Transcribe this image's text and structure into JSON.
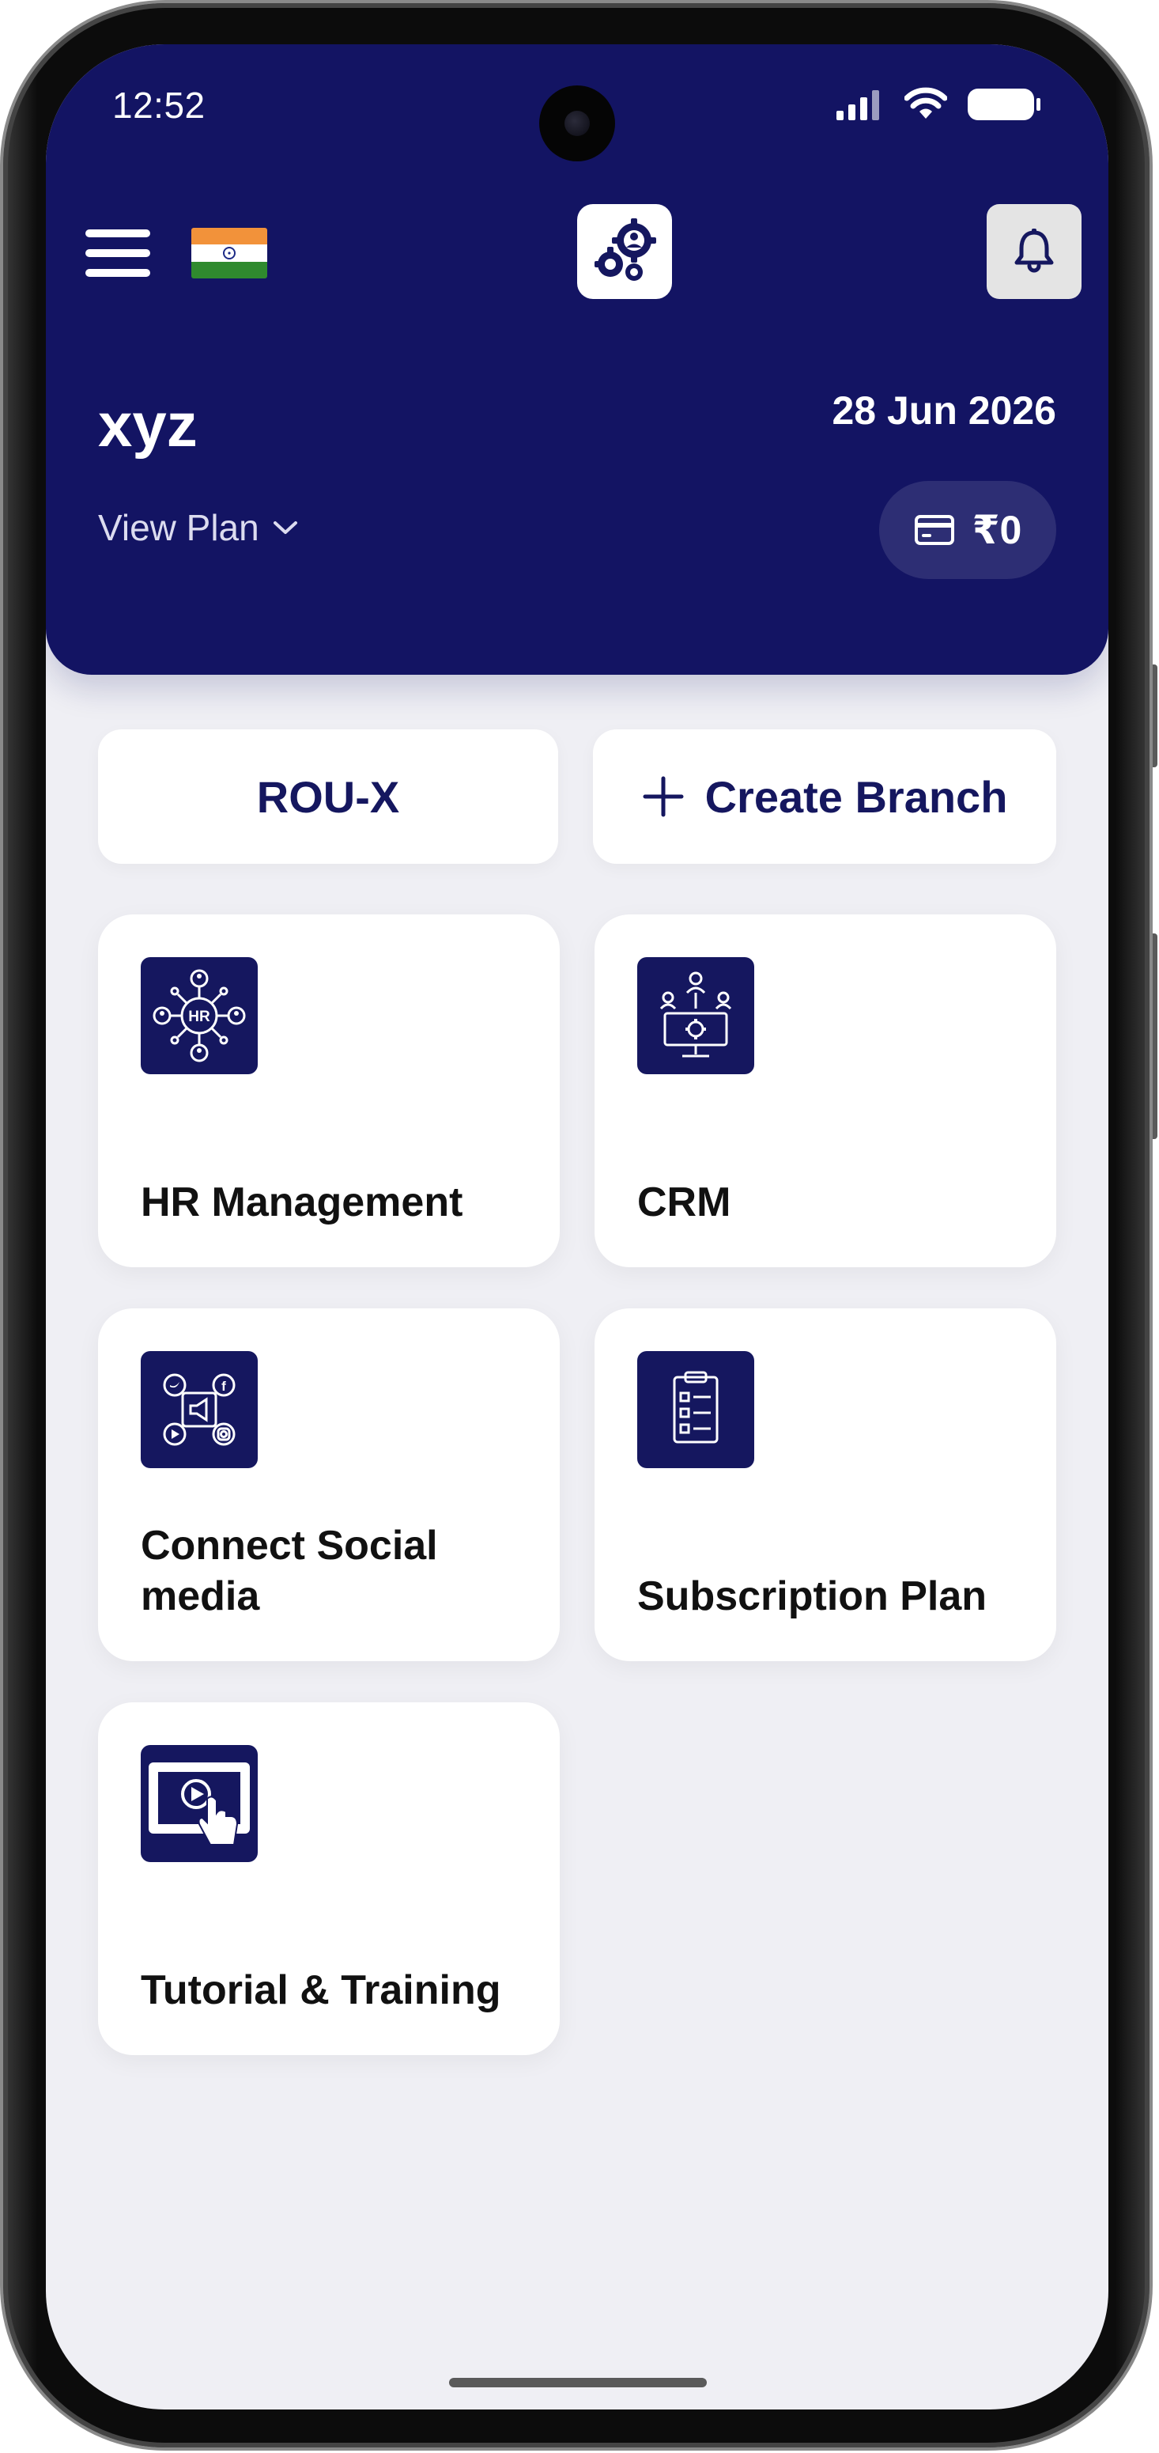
{
  "status_bar": {
    "time": "12:52"
  },
  "header": {
    "company_name": "xyz",
    "date": "28 Jun 2026",
    "view_plan_label": "View Plan",
    "wallet_amount": "₹0",
    "flag": "india-flag",
    "colors": {
      "primary": "#131463",
      "wallet_bg": "#2d2e74"
    }
  },
  "actions": {
    "branch_label": "ROU-X",
    "create_branch_label": "Create Branch"
  },
  "modules": [
    {
      "label": "HR Management",
      "icon": "hr-network-icon"
    },
    {
      "label": "CRM",
      "icon": "crm-team-icon"
    },
    {
      "label": "Connect Social media",
      "icon": "social-media-icon"
    },
    {
      "label": "Subscription Plan",
      "icon": "checklist-icon"
    },
    {
      "label": "Tutorial & Training",
      "icon": "video-tutorial-icon"
    }
  ]
}
